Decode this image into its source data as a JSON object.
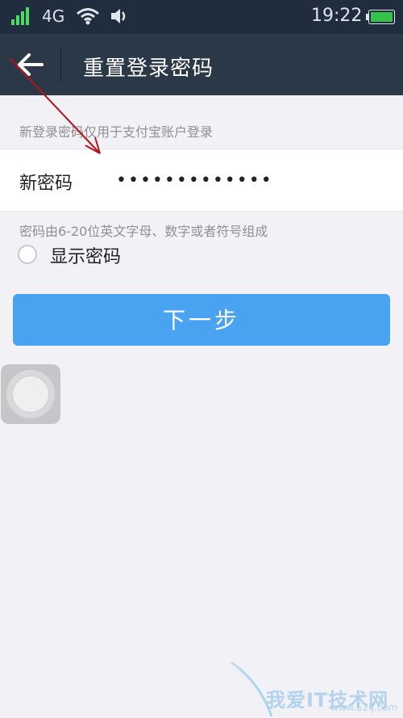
{
  "status_bar": {
    "network": "4G",
    "time": "19:22",
    "battery_color": "#35c24a"
  },
  "header": {
    "title": "重置登录密码",
    "background": "#2b3848"
  },
  "form": {
    "hint_top": "新登录密码仅用于支付宝账户登录",
    "password_label": "新密码",
    "password_value": "•••••••••••••",
    "hint_rule": "密码由6-20位英文字母、数字或者符号组成",
    "show_password_label": "显示密码",
    "show_password_checked": false,
    "next_button_label": "下一步",
    "next_button_color": "#4aa3f0"
  },
  "watermark": {
    "text": "我爱IT技术网",
    "url": "www.52ij.com"
  }
}
